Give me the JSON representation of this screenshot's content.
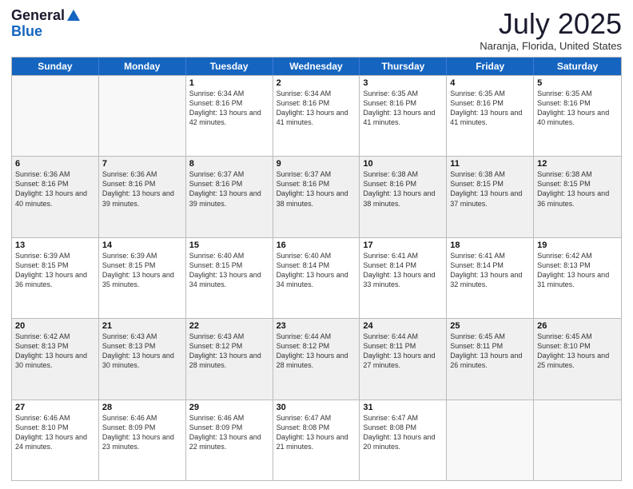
{
  "header": {
    "logo_line1": "General",
    "logo_line2": "Blue",
    "month": "July 2025",
    "location": "Naranja, Florida, United States"
  },
  "days_of_week": [
    "Sunday",
    "Monday",
    "Tuesday",
    "Wednesday",
    "Thursday",
    "Friday",
    "Saturday"
  ],
  "weeks": [
    [
      {
        "day": "",
        "empty": true
      },
      {
        "day": "",
        "empty": true
      },
      {
        "day": "1",
        "sunrise": "6:34 AM",
        "sunset": "8:16 PM",
        "daylight": "13 hours and 42 minutes."
      },
      {
        "day": "2",
        "sunrise": "6:34 AM",
        "sunset": "8:16 PM",
        "daylight": "13 hours and 41 minutes."
      },
      {
        "day": "3",
        "sunrise": "6:35 AM",
        "sunset": "8:16 PM",
        "daylight": "13 hours and 41 minutes."
      },
      {
        "day": "4",
        "sunrise": "6:35 AM",
        "sunset": "8:16 PM",
        "daylight": "13 hours and 41 minutes."
      },
      {
        "day": "5",
        "sunrise": "6:35 AM",
        "sunset": "8:16 PM",
        "daylight": "13 hours and 40 minutes."
      }
    ],
    [
      {
        "day": "6",
        "sunrise": "6:36 AM",
        "sunset": "8:16 PM",
        "daylight": "13 hours and 40 minutes."
      },
      {
        "day": "7",
        "sunrise": "6:36 AM",
        "sunset": "8:16 PM",
        "daylight": "13 hours and 39 minutes."
      },
      {
        "day": "8",
        "sunrise": "6:37 AM",
        "sunset": "8:16 PM",
        "daylight": "13 hours and 39 minutes."
      },
      {
        "day": "9",
        "sunrise": "6:37 AM",
        "sunset": "8:16 PM",
        "daylight": "13 hours and 38 minutes."
      },
      {
        "day": "10",
        "sunrise": "6:38 AM",
        "sunset": "8:16 PM",
        "daylight": "13 hours and 38 minutes."
      },
      {
        "day": "11",
        "sunrise": "6:38 AM",
        "sunset": "8:15 PM",
        "daylight": "13 hours and 37 minutes."
      },
      {
        "day": "12",
        "sunrise": "6:38 AM",
        "sunset": "8:15 PM",
        "daylight": "13 hours and 36 minutes."
      }
    ],
    [
      {
        "day": "13",
        "sunrise": "6:39 AM",
        "sunset": "8:15 PM",
        "daylight": "13 hours and 36 minutes."
      },
      {
        "day": "14",
        "sunrise": "6:39 AM",
        "sunset": "8:15 PM",
        "daylight": "13 hours and 35 minutes."
      },
      {
        "day": "15",
        "sunrise": "6:40 AM",
        "sunset": "8:15 PM",
        "daylight": "13 hours and 34 minutes."
      },
      {
        "day": "16",
        "sunrise": "6:40 AM",
        "sunset": "8:14 PM",
        "daylight": "13 hours and 34 minutes."
      },
      {
        "day": "17",
        "sunrise": "6:41 AM",
        "sunset": "8:14 PM",
        "daylight": "13 hours and 33 minutes."
      },
      {
        "day": "18",
        "sunrise": "6:41 AM",
        "sunset": "8:14 PM",
        "daylight": "13 hours and 32 minutes."
      },
      {
        "day": "19",
        "sunrise": "6:42 AM",
        "sunset": "8:13 PM",
        "daylight": "13 hours and 31 minutes."
      }
    ],
    [
      {
        "day": "20",
        "sunrise": "6:42 AM",
        "sunset": "8:13 PM",
        "daylight": "13 hours and 30 minutes."
      },
      {
        "day": "21",
        "sunrise": "6:43 AM",
        "sunset": "8:13 PM",
        "daylight": "13 hours and 30 minutes."
      },
      {
        "day": "22",
        "sunrise": "6:43 AM",
        "sunset": "8:12 PM",
        "daylight": "13 hours and 28 minutes."
      },
      {
        "day": "23",
        "sunrise": "6:44 AM",
        "sunset": "8:12 PM",
        "daylight": "13 hours and 28 minutes."
      },
      {
        "day": "24",
        "sunrise": "6:44 AM",
        "sunset": "8:11 PM",
        "daylight": "13 hours and 27 minutes."
      },
      {
        "day": "25",
        "sunrise": "6:45 AM",
        "sunset": "8:11 PM",
        "daylight": "13 hours and 26 minutes."
      },
      {
        "day": "26",
        "sunrise": "6:45 AM",
        "sunset": "8:10 PM",
        "daylight": "13 hours and 25 minutes."
      }
    ],
    [
      {
        "day": "27",
        "sunrise": "6:46 AM",
        "sunset": "8:10 PM",
        "daylight": "13 hours and 24 minutes."
      },
      {
        "day": "28",
        "sunrise": "6:46 AM",
        "sunset": "8:09 PM",
        "daylight": "13 hours and 23 minutes."
      },
      {
        "day": "29",
        "sunrise": "6:46 AM",
        "sunset": "8:09 PM",
        "daylight": "13 hours and 22 minutes."
      },
      {
        "day": "30",
        "sunrise": "6:47 AM",
        "sunset": "8:08 PM",
        "daylight": "13 hours and 21 minutes."
      },
      {
        "day": "31",
        "sunrise": "6:47 AM",
        "sunset": "8:08 PM",
        "daylight": "13 hours and 20 minutes."
      },
      {
        "day": "",
        "empty": true
      },
      {
        "day": "",
        "empty": true
      }
    ]
  ]
}
